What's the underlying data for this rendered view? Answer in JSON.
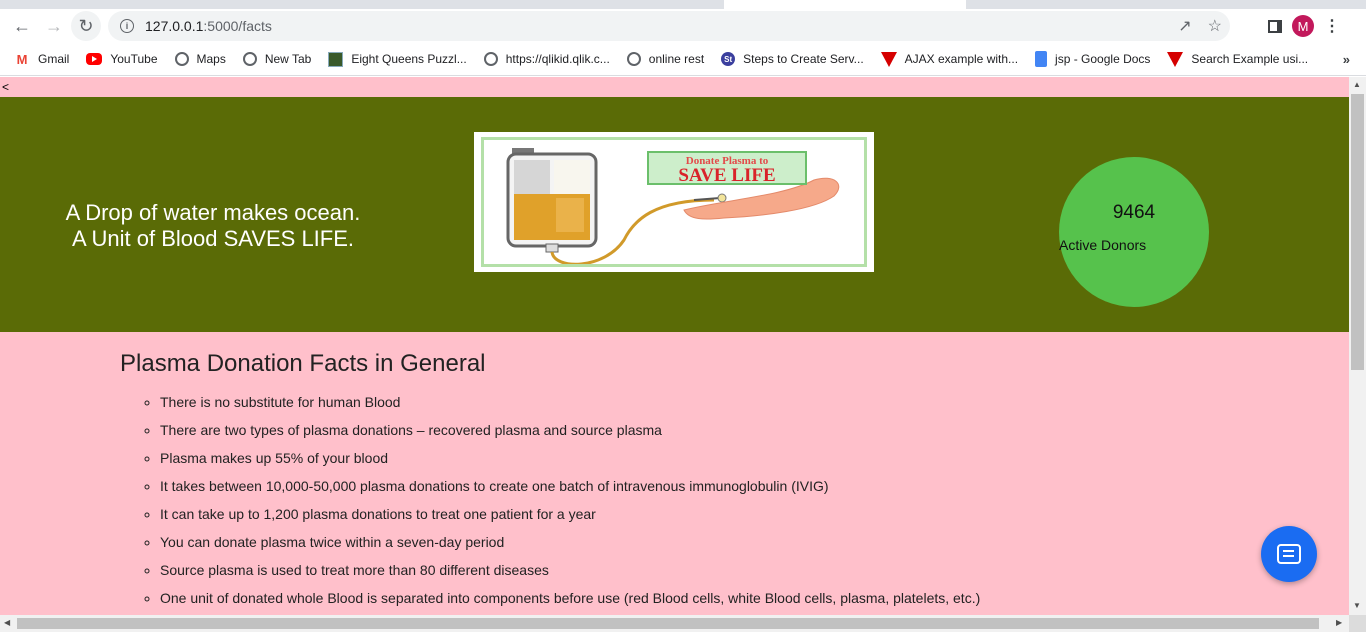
{
  "browser": {
    "url_host": "127.0.0.1",
    "url_path": ":5000/facts",
    "profile_initial": "M",
    "bookmarks": [
      {
        "label": "Gmail",
        "icon": "gmail-icon"
      },
      {
        "label": "YouTube",
        "icon": "youtube-icon"
      },
      {
        "label": "Maps",
        "icon": "globe-icon"
      },
      {
        "label": "New Tab",
        "icon": "globe-icon"
      },
      {
        "label": "Eight Queens Puzzl...",
        "icon": "puzzle-icon"
      },
      {
        "label": "https://qlikid.qlik.c...",
        "icon": "globe-icon"
      },
      {
        "label": "online rest",
        "icon": "globe-icon"
      },
      {
        "label": "Steps to Create Serv...",
        "icon": "st-icon"
      },
      {
        "label": "AJAX example with...",
        "icon": "red-triangle-icon"
      },
      {
        "label": "jsp - Google Docs",
        "icon": "docs-icon"
      },
      {
        "label": "Search Example usi...",
        "icon": "red-triangle-icon"
      }
    ],
    "more_label": "»"
  },
  "page": {
    "back_link": "<",
    "motto_line1": "A Drop of water makes ocean.",
    "motto_line2": "A Unit of Blood SAVES LIFE.",
    "poster_top": "Donate Plasma to",
    "poster_main": "SAVE LIFE",
    "donor_count": "9464",
    "donor_label": "Active Donors",
    "facts_title": "Plasma Donation Facts in General",
    "facts": [
      "There is no substitute for human Blood",
      "There are two types of plasma donations – recovered plasma and source plasma",
      "Plasma makes up 55% of your blood",
      "It takes between 10,000-50,000 plasma donations to create one batch of intravenous immunoglobulin (IVIG)",
      "It can take up to 1,200 plasma donations to treat one patient for a year",
      "You can donate plasma twice within a seven-day period",
      "Source plasma is used to treat more than 80 different diseases",
      "One unit of donated whole Blood is separated into components before use (red Blood cells, white Blood cells, plasma, platelets, etc.)"
    ]
  },
  "colors": {
    "page_bg": "#ffc0cb",
    "banner_bg": "#5a6b06",
    "donor_circle": "#56c24c",
    "chat_button": "#1a6cf2"
  }
}
